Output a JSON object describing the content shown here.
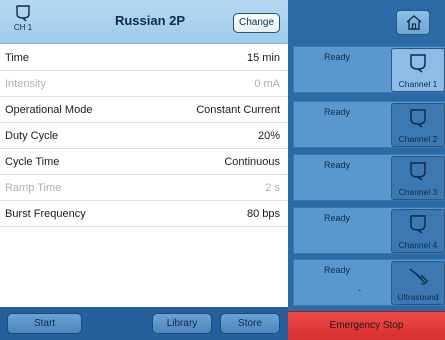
{
  "header": {
    "channel_label": "CH 1",
    "program_title": "Russian 2P",
    "change_label": "Change"
  },
  "params": [
    {
      "label": "Time",
      "value": "15 min",
      "enabled": true
    },
    {
      "label": "Intensity",
      "value": "0 mA",
      "enabled": false
    },
    {
      "label": "Operational Mode",
      "value": "Constant Current",
      "enabled": true
    },
    {
      "label": "Duty Cycle",
      "value": "20%",
      "enabled": true
    },
    {
      "label": "Cycle Time",
      "value": "Continuous",
      "enabled": true
    },
    {
      "label": "Ramp Time",
      "value": "2 s",
      "enabled": false
    },
    {
      "label": "Burst Frequency",
      "value": "80 bps",
      "enabled": true
    }
  ],
  "footer": {
    "start_label": "Start",
    "library_label": "Library",
    "store_label": "Store"
  },
  "channels": [
    {
      "status": "Ready",
      "name": "Channel 1",
      "icon": "electrode-icon",
      "style": "light"
    },
    {
      "status": "Ready",
      "name": "Channel 2",
      "icon": "electrode-icon",
      "style": "dark"
    },
    {
      "status": "Ready",
      "name": "Channel 3",
      "icon": "electrode-icon",
      "style": "dark"
    },
    {
      "status": "Ready",
      "name": "Channel 4",
      "icon": "electrode-icon",
      "style": "dark"
    },
    {
      "status": "Ready",
      "extra": "-",
      "name": "Ultrasound",
      "icon": "ultrasound-icon",
      "style": "dark"
    }
  ],
  "emergency_stop_label": "Emergency Stop",
  "colors": {
    "header_bg": "#b6d9f2",
    "footer_bg": "#26609c",
    "right_bg": "#2b6aa6",
    "card_bg": "#5a97cf",
    "emergency": "#e23b3b"
  }
}
